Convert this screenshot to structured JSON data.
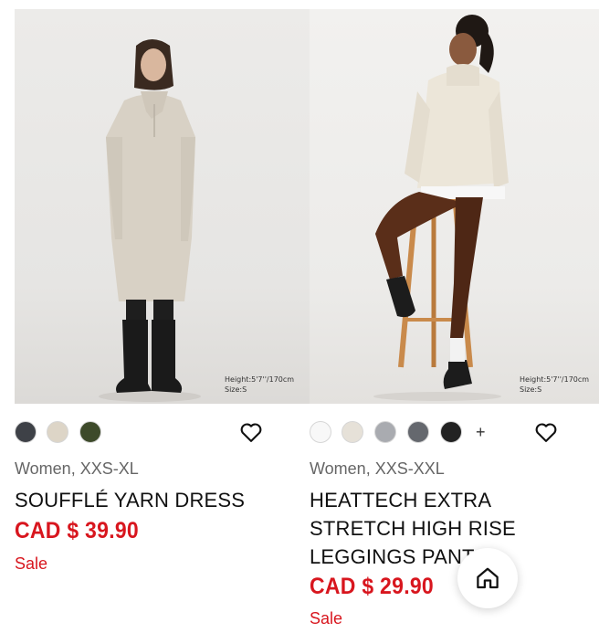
{
  "products": [
    {
      "image_alt": "woman wearing beige half-zip knit dress with black boots",
      "model_note": {
        "height": "Height:5'7''/170cm",
        "size": "Size:S"
      },
      "swatches": [
        "#3e4147",
        "#ddd5c7",
        "#3d4a2a"
      ],
      "has_more_colors": false,
      "more_symbol": "",
      "meta": "Women, XXS-XL",
      "name": "SOUFFLÉ YARN DRESS",
      "price": "CAD $ 39.90",
      "sale_label": "Sale"
    },
    {
      "image_alt": "woman in cream turtleneck sweater and brown leggings sitting on a wooden stool",
      "model_note": {
        "height": "Height:5'7''/170cm",
        "size": "Size:S"
      },
      "swatches": [
        "#f8f8f8",
        "#e6e1d8",
        "#a9abb0",
        "#65686e",
        "#222222"
      ],
      "has_more_colors": true,
      "more_symbol": "+",
      "meta": "Women, XXS-XXL",
      "name": "HEATTECH EXTRA STRETCH HIGH RISE LEGGINGS PANTS",
      "price": "CAD $ 29.90",
      "sale_label": "Sale"
    }
  ],
  "icons": {
    "wishlist": "heart-icon",
    "home": "home-icon"
  },
  "colors": {
    "price_red": "#d8161e",
    "meta_gray": "#666666"
  }
}
